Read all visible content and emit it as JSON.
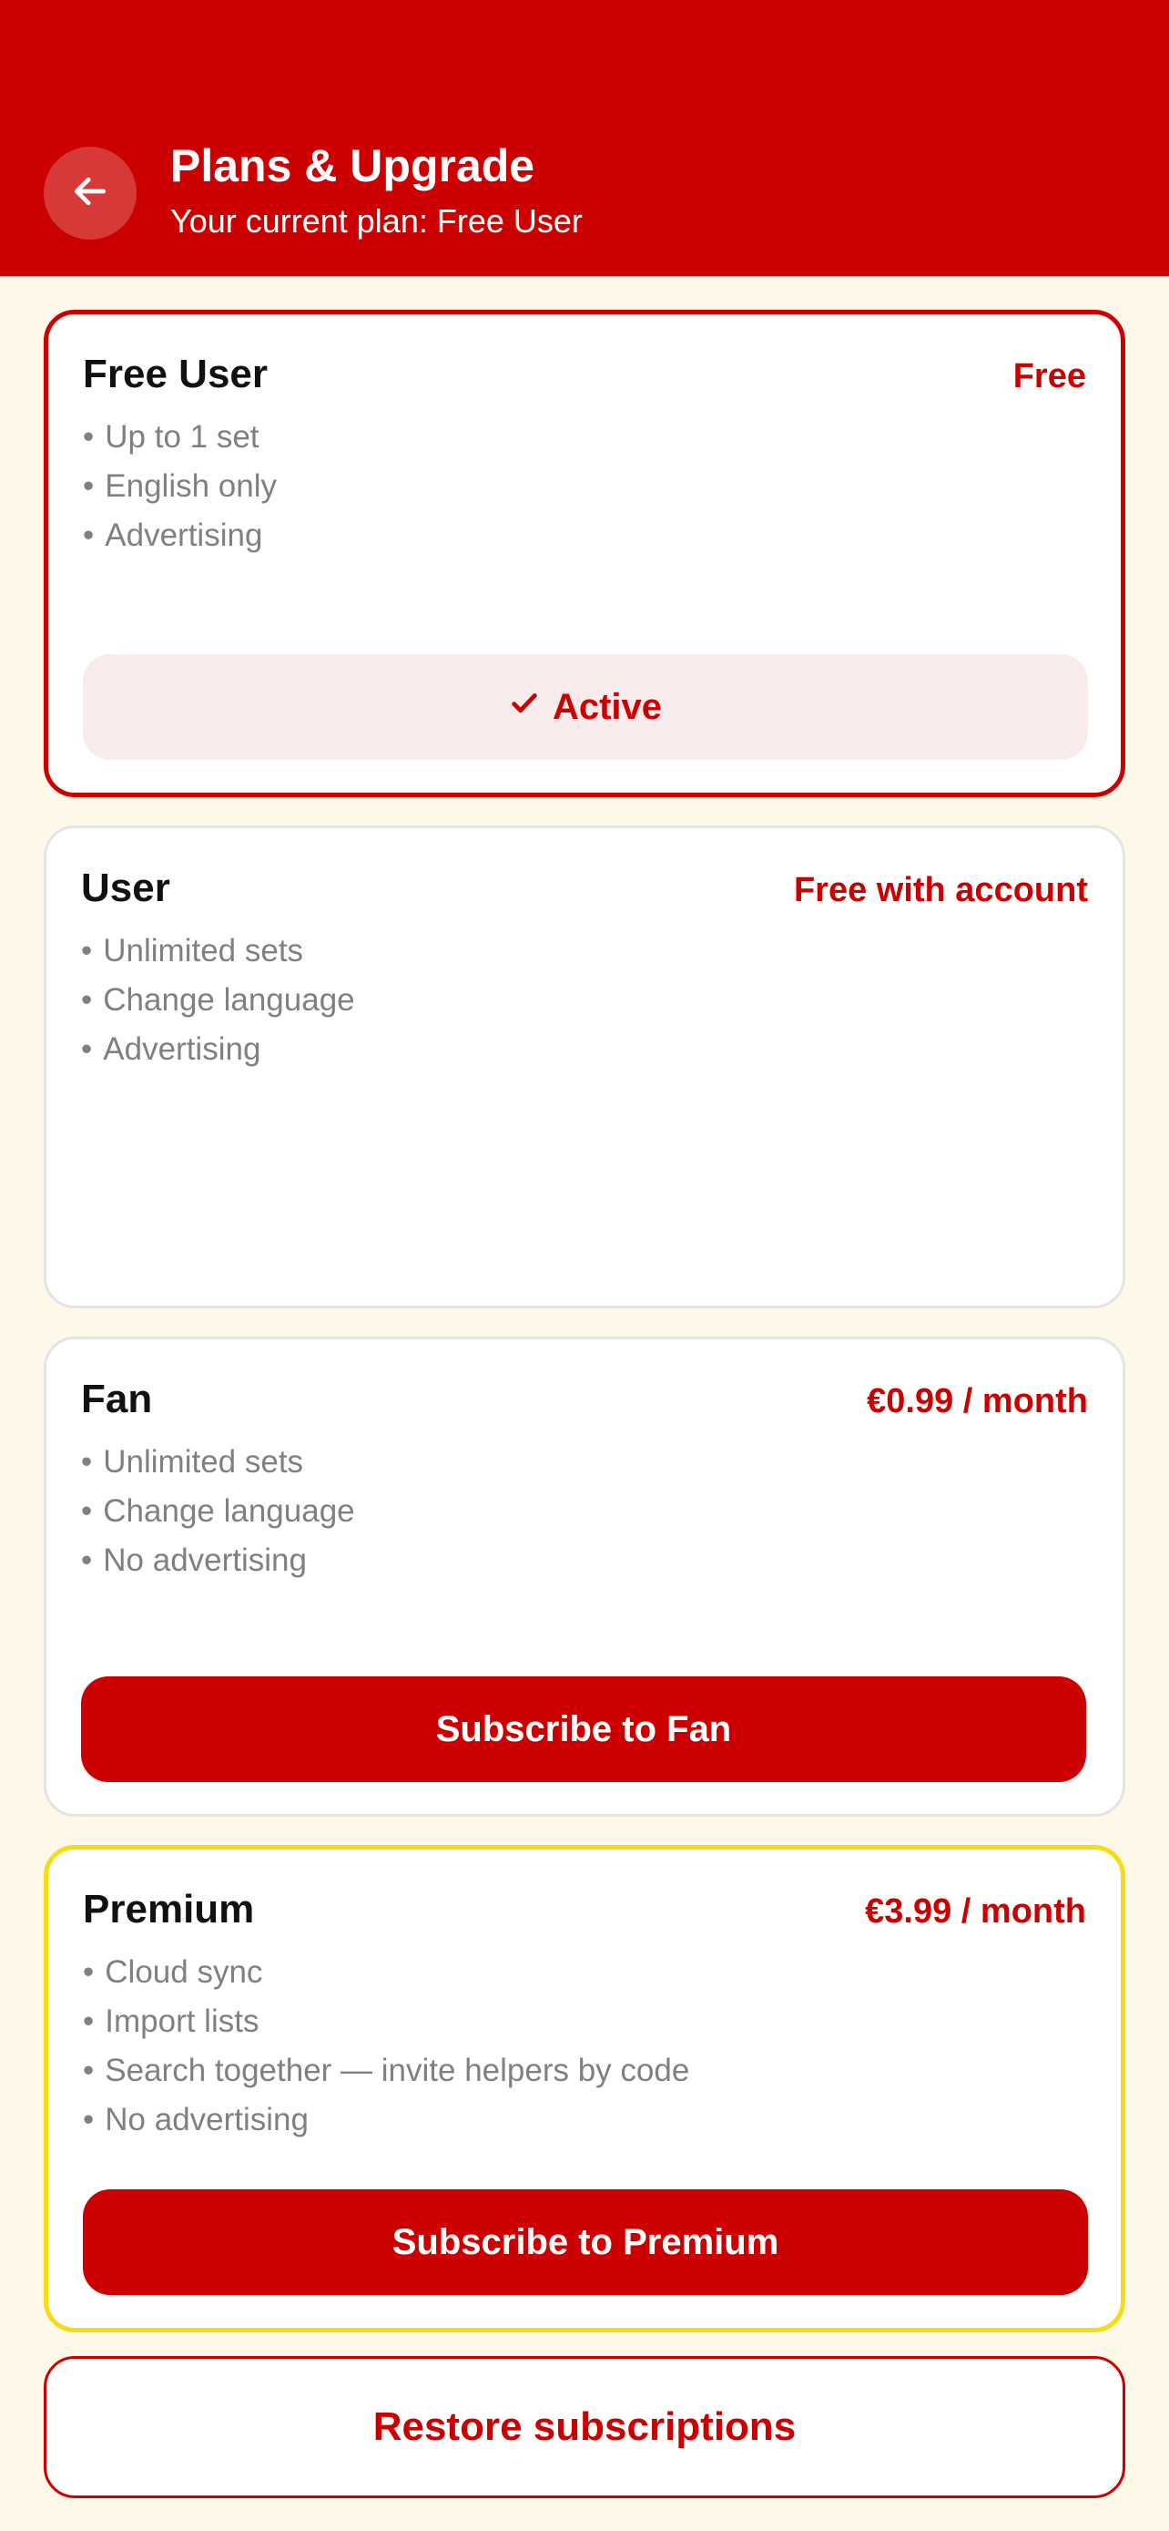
{
  "header": {
    "title": "Plans & Upgrade",
    "subtitle": "Your current plan: Free User",
    "back_icon": "arrow-left-icon"
  },
  "colors": {
    "brand": "#cc0000",
    "background": "#fdf8e8",
    "premium_border": "#f5dc14",
    "muted_text": "#808080"
  },
  "plans": [
    {
      "name": "Free User",
      "price": "Free",
      "features": [
        "Up to 1 set",
        "English only",
        "Advertising"
      ],
      "button": "Active",
      "button_icon": "checkmark-icon",
      "is_current": true
    },
    {
      "name": "User",
      "price": "Free with account",
      "features": [
        "Unlimited sets",
        "Change language",
        "Advertising"
      ]
    },
    {
      "name": "Fan",
      "price": "€0.99 / month",
      "features": [
        "Unlimited sets",
        "Change language",
        "No advertising"
      ],
      "button": "Subscribe to Fan"
    },
    {
      "name": "Premium",
      "price": "€3.99 / month",
      "features": [
        "Cloud sync",
        "Import lists",
        "Search together — invite helpers by code",
        "No advertising"
      ],
      "button": "Subscribe to Premium"
    }
  ],
  "restore_label": "Restore subscriptions"
}
